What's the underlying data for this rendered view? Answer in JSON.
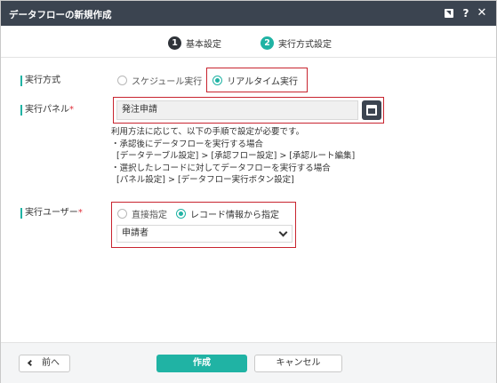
{
  "dialog": {
    "title": "データフローの新規作成",
    "help_icon": "?",
    "close_icon": "✕"
  },
  "steps": [
    {
      "number": "1",
      "label": "基本設定"
    },
    {
      "number": "2",
      "label": "実行方式設定"
    }
  ],
  "exec_method": {
    "label": "実行方式",
    "options": [
      {
        "label": "スケジュール実行",
        "selected": false
      },
      {
        "label": "リアルタイム実行",
        "selected": true
      }
    ]
  },
  "exec_panel": {
    "label": "実行パネル",
    "required_mark": "*",
    "value": "発注申請",
    "help_text": "利用方法に応じて、以下の手順で設定が必要です。\n・承認後にデータフローを実行する場合\n  [データテーブル設定] > [承認フロー設定] > [承認ルート編集]\n・選択したレコードに対してデータフローを実行する場合\n  [パネル設定] > [データフロー実行ボタン設定]"
  },
  "exec_user": {
    "label": "実行ユーザー",
    "required_mark": "*",
    "options": [
      {
        "label": "直接指定",
        "selected": false
      },
      {
        "label": "レコード情報から指定",
        "selected": true
      }
    ],
    "select_value": "申請者"
  },
  "footer": {
    "back_label": "前へ",
    "create_label": "作成",
    "cancel_label": "キャンセル"
  },
  "colors": {
    "titlebar": "#3b4450",
    "accent": "#20b3a4",
    "highlight_border": "#c8242f",
    "required": "#e0303b"
  }
}
